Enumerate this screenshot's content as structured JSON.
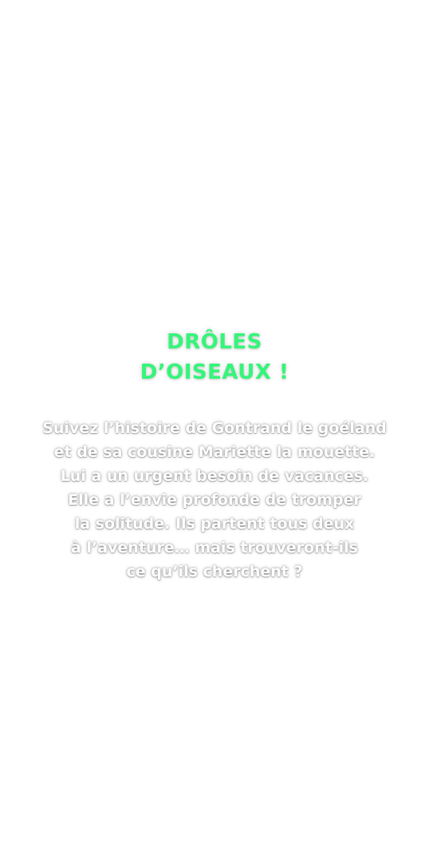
{
  "title": {
    "line1": "DRÔLES",
    "line2": "D’OISEAUX !"
  },
  "blurb": {
    "lines": [
      "Suivez l’histoire de Gontrand le goéland",
      "et de sa cousine Mariette la mouette.",
      "Lui a un urgent besoin de vacances.",
      "Elle a l’envie profonde de tromper",
      "la solitude. Ils partent tous deux",
      "à l’aventure… mais trouveront-ils",
      "ce qu’ils cherchent ?"
    ]
  },
  "colors": {
    "title": "#35f57a",
    "blurb_text": "#ffffff",
    "background": "#ffffff"
  }
}
